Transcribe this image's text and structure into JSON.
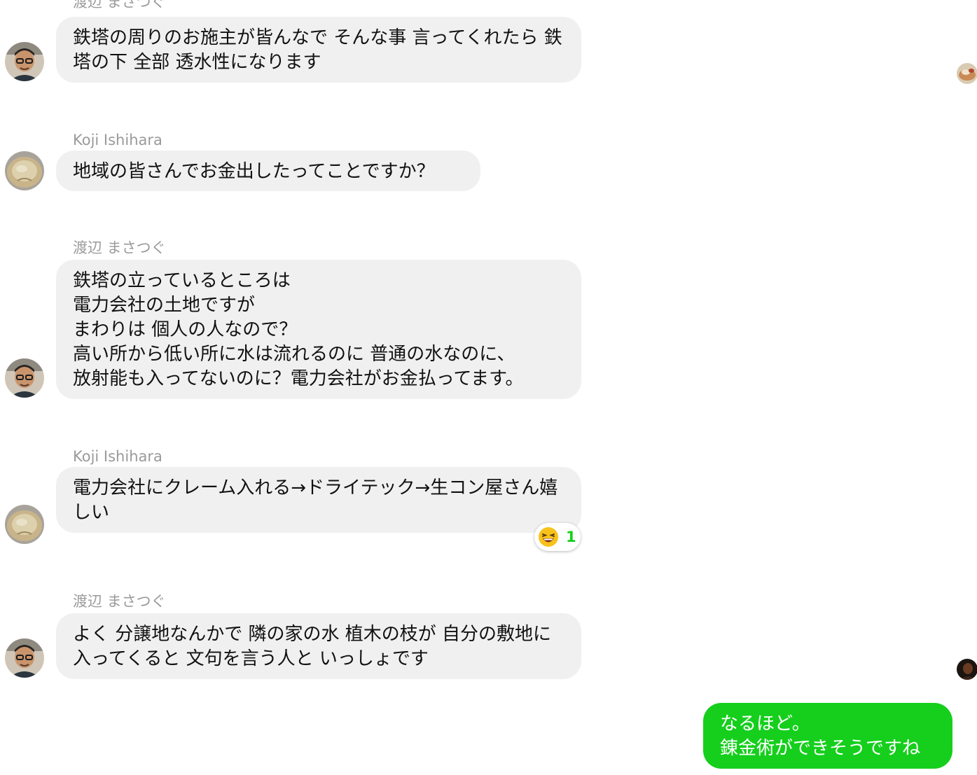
{
  "messages": [
    {
      "sender": "渡辺 まさつぐ",
      "text": "鉄塔の周りのお施主が皆んなで そんな事 言ってくれたら 鉄塔の下 全部 透水性になります",
      "avatar": "masatsugu-avatar"
    },
    {
      "sender": "Koji Ishihara",
      "text": "地域の皆さんでお金出したってことですか？",
      "avatar": "koji-avatar"
    },
    {
      "sender": "渡辺 まさつぐ",
      "text": "鉄塔の立っているところは\n電力会社の土地ですが\nまわりは 個人の人なので？\n高い所から低い所に水は流れるのに 普通の水なのに、\n放射能も入ってないのに？電力会社がお金払ってます。",
      "avatar": "masatsugu-avatar"
    },
    {
      "sender": "Koji Ishihara",
      "text": "電力会社にクレーム入れる→ドライテック→生コン屋さん嬉しい",
      "avatar": "koji-avatar",
      "reaction": {
        "emoji": "laughing-face",
        "count": "1"
      }
    },
    {
      "sender": "渡辺 まさつぐ",
      "text": "よく 分譲地なんかで 隣の家の水 植木の枝が 自分の敷地に入ってくると 文句を言う人と いっしょです",
      "avatar": "masatsugu-avatar"
    },
    {
      "sender": "",
      "text": "なるほど。\n錬金術ができそうですね",
      "own": true
    }
  ],
  "colors": {
    "incoming_bubble": "#f0f0f0",
    "outgoing_bubble": "#15cf1c",
    "sender_name": "#9a9a9a",
    "reaction_count": "#15cf1c"
  },
  "icons": {
    "masatsugu_avatar": "man-with-glasses-photo",
    "koji_avatar": "bowl-photo",
    "seen_indicator_1": "reader-avatar-food-photo",
    "seen_indicator_2": "reader-avatar-dark-photo",
    "reaction": "laughing-face-emoji"
  }
}
